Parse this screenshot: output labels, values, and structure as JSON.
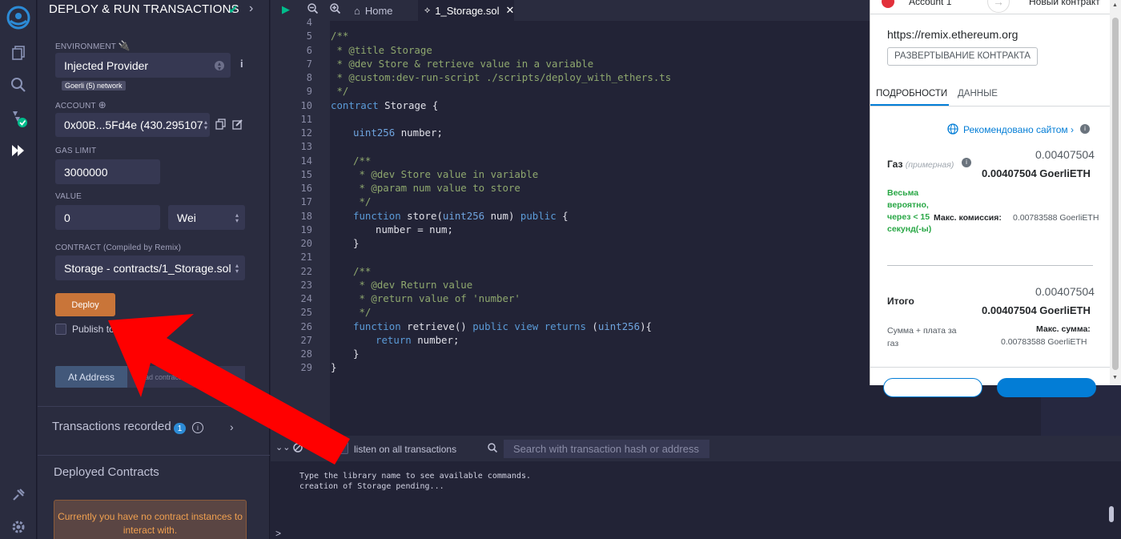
{
  "panel": {
    "title": "DEPLOY & RUN TRANSACTIONS",
    "environment_label": "ENVIRONMENT",
    "environment_value": "Injected Provider",
    "network_badge": "Goerli (5) network",
    "account_label": "ACCOUNT",
    "account_value": "0x00B...5Fd4e (430.295107",
    "gas_limit_label": "GAS LIMIT",
    "gas_limit_value": "3000000",
    "value_label": "VALUE",
    "value_amount": "0",
    "value_unit": "Wei",
    "contract_label": "CONTRACT",
    "contract_sublabel": "(Compiled by Remix)",
    "contract_value": "Storage - contracts/1_Storage.sol",
    "deploy_label": "Deploy",
    "publish_label": "Publish to IPFS",
    "at_address_label": "At Address",
    "load_contract_placeholder": "Load contract from Address",
    "tx_recorded_label": "Transactions recorded",
    "tx_recorded_count": "1",
    "deployed_label": "Deployed Contracts",
    "no_contract_msg": "Currently you have no contract instances to interact with."
  },
  "editor": {
    "home_tab": "Home",
    "file_tab": "1_Storage.sol",
    "lines": [
      {
        "n": "4",
        "indent": 0,
        "parts": []
      },
      {
        "n": "5",
        "indent": 0,
        "parts": [
          {
            "c": "c-cm",
            "t": "/**"
          }
        ]
      },
      {
        "n": "6",
        "indent": 0,
        "parts": [
          {
            "c": "c-cm",
            "t": " * @title Storage"
          }
        ]
      },
      {
        "n": "7",
        "indent": 0,
        "parts": [
          {
            "c": "c-cm",
            "t": " * @dev Store & retrieve value in a variable"
          }
        ]
      },
      {
        "n": "8",
        "indent": 0,
        "parts": [
          {
            "c": "c-cm",
            "t": " * @custom:dev-run-script ./scripts/deploy_with_ethers.ts"
          }
        ]
      },
      {
        "n": "9",
        "indent": 0,
        "parts": [
          {
            "c": "c-cm",
            "t": " */"
          }
        ]
      },
      {
        "n": "10",
        "indent": 0,
        "parts": [
          {
            "c": "c-kw",
            "t": "contract "
          },
          {
            "c": "c-tx",
            "t": "Storage {"
          }
        ]
      },
      {
        "n": "11",
        "indent": 0,
        "parts": []
      },
      {
        "n": "12",
        "indent": 1,
        "parts": [
          {
            "c": "c-ty",
            "t": "uint256 "
          },
          {
            "c": "c-tx",
            "t": "number;"
          }
        ]
      },
      {
        "n": "13",
        "indent": 0,
        "parts": []
      },
      {
        "n": "14",
        "indent": 1,
        "parts": [
          {
            "c": "c-cm",
            "t": "/**"
          }
        ]
      },
      {
        "n": "15",
        "indent": 1,
        "parts": [
          {
            "c": "c-cm",
            "t": " * @dev Store value in variable"
          }
        ]
      },
      {
        "n": "16",
        "indent": 1,
        "parts": [
          {
            "c": "c-cm",
            "t": " * @param num value to store"
          }
        ]
      },
      {
        "n": "17",
        "indent": 1,
        "parts": [
          {
            "c": "c-cm",
            "t": " */"
          }
        ]
      },
      {
        "n": "18",
        "indent": 1,
        "parts": [
          {
            "c": "c-kw",
            "t": "function "
          },
          {
            "c": "c-tx",
            "t": "store("
          },
          {
            "c": "c-ty",
            "t": "uint256"
          },
          {
            "c": "c-tx",
            "t": " num) "
          },
          {
            "c": "c-kw",
            "t": "public"
          },
          {
            "c": "c-tx",
            "t": " {"
          }
        ]
      },
      {
        "n": "19",
        "indent": 2,
        "parts": [
          {
            "c": "c-tx",
            "t": "number = num;"
          }
        ]
      },
      {
        "n": "20",
        "indent": 1,
        "parts": [
          {
            "c": "c-tx",
            "t": "}"
          }
        ]
      },
      {
        "n": "21",
        "indent": 0,
        "parts": []
      },
      {
        "n": "22",
        "indent": 1,
        "parts": [
          {
            "c": "c-cm",
            "t": "/**"
          }
        ]
      },
      {
        "n": "23",
        "indent": 1,
        "parts": [
          {
            "c": "c-cm",
            "t": " * @dev Return value"
          }
        ]
      },
      {
        "n": "24",
        "indent": 1,
        "parts": [
          {
            "c": "c-cm",
            "t": " * @return value of 'number'"
          }
        ]
      },
      {
        "n": "25",
        "indent": 1,
        "parts": [
          {
            "c": "c-cm",
            "t": " */"
          }
        ]
      },
      {
        "n": "26",
        "indent": 1,
        "parts": [
          {
            "c": "c-kw",
            "t": "function "
          },
          {
            "c": "c-tx",
            "t": "retrieve() "
          },
          {
            "c": "c-kw",
            "t": "public view returns"
          },
          {
            "c": "c-tx",
            "t": " ("
          },
          {
            "c": "c-ty",
            "t": "uint256"
          },
          {
            "c": "c-tx",
            "t": "){"
          }
        ]
      },
      {
        "n": "27",
        "indent": 2,
        "parts": [
          {
            "c": "c-kw",
            "t": "return "
          },
          {
            "c": "c-tx",
            "t": "number;"
          }
        ]
      },
      {
        "n": "28",
        "indent": 1,
        "parts": [
          {
            "c": "c-tx",
            "t": "}"
          }
        ]
      },
      {
        "n": "29",
        "indent": 0,
        "parts": [
          {
            "c": "c-tx",
            "t": "}"
          }
        ]
      }
    ]
  },
  "terminal": {
    "count": "0",
    "listen_label": "listen on all transactions",
    "search_placeholder": "Search with transaction hash or address",
    "line1": "Type the library name to see available commands.",
    "line2": "creation of Storage pending...",
    "prompt": ">"
  },
  "metamask": {
    "account": "Account 1",
    "new_contract": "Новый контракт",
    "origin": "https://remix.ethereum.org",
    "deploy_badge": "РАЗВЕРТЫВАНИЕ КОНТРАКТА",
    "tab_details": "ПОДРОБНОСТИ",
    "tab_data": "ДАННЫЕ",
    "recommended": "Рекомендовано сайтом",
    "gas_label": "Газ",
    "gas_est": "(примерная)",
    "gas_small": "0.00407504",
    "gas_big": "0.00407504 GoerliETH",
    "likely": "Весьма вероятно, через < 15 секунд(-ы)",
    "max_fee_label": "Макс. комиссия:",
    "max_fee_value": "0.00783588 GoerliETH",
    "total_label": "Итого",
    "total_small": "0.00407504",
    "total_big": "0.00407504 GoerliETH",
    "sum_label": "Сумма + плата за газ",
    "max_sum_label": "Макс. сумма:",
    "max_sum_value": "0.00783588 GoerliETH"
  },
  "colors": {
    "deploy": "#c97539",
    "arrow": "#ff0000",
    "mm_accent": "#037dd6",
    "success": "#28a745"
  }
}
